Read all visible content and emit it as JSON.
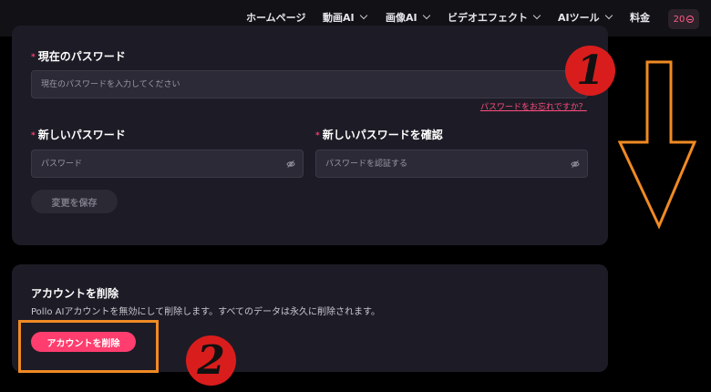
{
  "nav": {
    "items": [
      {
        "label": "ホームページ",
        "dropdown": false
      },
      {
        "label": "動画AI",
        "dropdown": true
      },
      {
        "label": "画像AI",
        "dropdown": true
      },
      {
        "label": "ビデオエフェクト",
        "dropdown": true
      },
      {
        "label": "AIツール",
        "dropdown": true
      },
      {
        "label": "料金",
        "dropdown": false
      }
    ],
    "credits": "20"
  },
  "password_form": {
    "current_label": "現在のパスワード",
    "current_placeholder": "現在のパスワードを入力してください",
    "forgot_link": "パスワードをお忘れですか？",
    "new_label": "新しいパスワード",
    "new_placeholder": "パスワード",
    "confirm_label": "新しいパスワードを確認",
    "confirm_placeholder": "パスワードを認証する",
    "required_mark": "*",
    "save_button": "変更を保存"
  },
  "delete_account": {
    "title": "アカウントを削除",
    "description": "Pollo AIアカウントを無効にして削除します。すべてのデータは永久に削除されます。",
    "button": "アカウントを削除"
  },
  "annotations": {
    "step1": "1",
    "step2": "2",
    "highlight_color": "#f08a24",
    "badge_color": "#d91d1d"
  },
  "colors": {
    "accent": "#ff3d6e",
    "card_bg": "#1d1c26",
    "page_bg": "#000000"
  }
}
